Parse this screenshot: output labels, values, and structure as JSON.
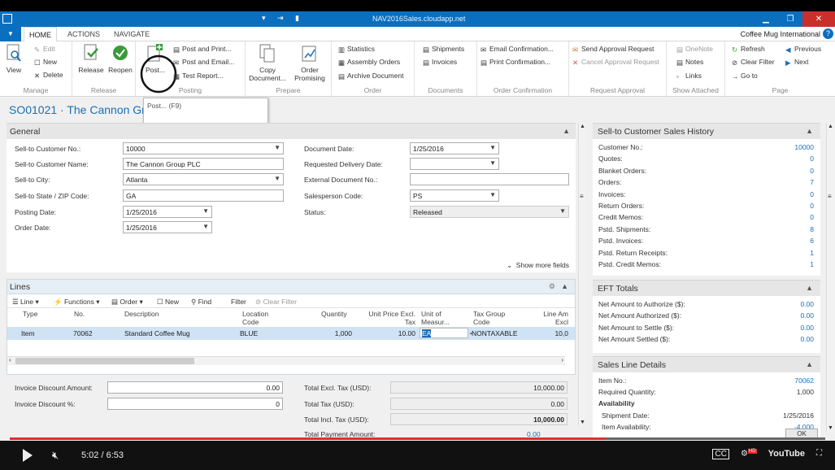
{
  "titlebar": {
    "title": "NAV2016Sales.cloudapp.net"
  },
  "tabs": {
    "home": "HOME",
    "actions": "ACTIONS",
    "navigate": "NAVIGATE",
    "company": "Coffee Mug International",
    "help": "?"
  },
  "ribbon": {
    "manage": {
      "name": "Manage",
      "view": "View",
      "edit": "Edit",
      "new": "New",
      "delete": "Delete"
    },
    "release": {
      "name": "Release",
      "release": "Release",
      "reopen": "Reopen"
    },
    "posting": {
      "name": "Posting",
      "post": "Post...",
      "post_print": "Post and Print...",
      "post_email": "Post and Email...",
      "test_report": "Test Report..."
    },
    "prepare": {
      "name": "Prepare",
      "copy_document": "Copy Document...",
      "order_promising": "Order Promising"
    },
    "order": {
      "name": "Order",
      "statistics": "Statistics",
      "assembly_orders": "Assembly Orders",
      "archive_document": "Archive Document"
    },
    "documents": {
      "name": "Documents",
      "shipments": "Shipments",
      "invoices": "Invoices"
    },
    "order_confirmation": {
      "name": "Order Confirmation",
      "email_confirmation": "Email Confirmation...",
      "print_confirmation": "Print Confirmation..."
    },
    "request_approval": {
      "name": "Request Approval",
      "send": "Send Approval Request",
      "cancel": "Cancel Approval Request"
    },
    "show_attached": {
      "name": "Show Attached",
      "onenote": "OneNote",
      "notes": "Notes",
      "links": "Links"
    },
    "page": {
      "name": "Page",
      "refresh": "Refresh",
      "clear_filter": "Clear Filter",
      "go_to": "Go to",
      "previous": "Previous",
      "next": "Next"
    }
  },
  "page_title": "SO01021 · The Cannon Grou",
  "tooltip": "Post... (F9)",
  "general": {
    "title": "General",
    "fields": {
      "sell_to_no_label": "Sell-to Customer No.:",
      "sell_to_no": "10000",
      "sell_to_name_label": "Sell-to Customer Name:",
      "sell_to_name": "The Cannon Group PLC",
      "city_label": "Sell-to City:",
      "city": "Atlanta",
      "state_label": "Sell-to State / ZIP Code:",
      "state": "GA",
      "posting_date_label": "Posting Date:",
      "posting_date": "1/25/2016",
      "order_date_label": "Order Date:",
      "order_date": "1/25/2016",
      "document_date_label": "Document Date:",
      "document_date": "1/25/2016",
      "req_delivery_label": "Requested Delivery Date:",
      "req_delivery": "",
      "ext_doc_label": "External Document No.:",
      "ext_doc": "",
      "salesperson_label": "Salesperson Code:",
      "salesperson": "PS",
      "status_label": "Status:",
      "status": "Released"
    },
    "show_more": "Show more fields"
  },
  "lines": {
    "title": "Lines",
    "toolbar": {
      "line": "Line",
      "functions": "Functions",
      "order": "Order",
      "new": "New",
      "find": "Find",
      "filter": "Filter",
      "clear_filter": "Clear Filter"
    },
    "columns": [
      "Type",
      "No.",
      "Description",
      "Location Code",
      "Quantity",
      "Unit Price Excl. Tax",
      "Unit of Measur...",
      "Tax Group Code",
      "Line Am Excl"
    ],
    "rows": [
      {
        "type": "Item",
        "no": "70062",
        "description": "Standard Coffee Mug",
        "location": "BLUE",
        "quantity": "1,000",
        "unit_price": "10.00",
        "uom": "EA",
        "tax_group": "NONTAXABLE",
        "line_amount": "10,0"
      }
    ]
  },
  "totals": {
    "inv_disc_amount_label": "Invoice Discount Amount:",
    "inv_disc_amount": "0.00",
    "inv_disc_pct_label": "Invoice Discount %:",
    "inv_disc_pct": "0",
    "total_excl_label": "Total Excl. Tax (USD):",
    "total_excl": "10,000.00",
    "total_tax_label": "Total Tax (USD):",
    "total_tax": "0.00",
    "total_incl_label": "Total Incl. Tax (USD):",
    "total_incl": "10,000.00",
    "total_payment_label": "Total Payment Amount:",
    "total_payment": "0.00"
  },
  "factbox": {
    "history": {
      "title": "Sell-to Customer Sales History",
      "rows": [
        {
          "label": "Customer No.:",
          "value": "10000"
        },
        {
          "label": "Quotes:",
          "value": "0"
        },
        {
          "label": "Blanket Orders:",
          "value": "0"
        },
        {
          "label": "Orders:",
          "value": "7"
        },
        {
          "label": "Invoices:",
          "value": "0"
        },
        {
          "label": "Return Orders:",
          "value": "0"
        },
        {
          "label": "Credit Memos:",
          "value": "0"
        },
        {
          "label": "Pstd. Shipments:",
          "value": "8"
        },
        {
          "label": "Pstd. Invoices:",
          "value": "6"
        },
        {
          "label": "Pstd. Return Receipts:",
          "value": "1"
        },
        {
          "label": "Pstd. Credit Memos:",
          "value": "1"
        }
      ]
    },
    "eft": {
      "title": "EFT Totals",
      "rows": [
        {
          "label": "Net Amount to Authorize ($):",
          "value": "0.00"
        },
        {
          "label": "Net Amount Authorized ($):",
          "value": "0.00"
        },
        {
          "label": "Net Amount to Settle ($):",
          "value": "0.00"
        },
        {
          "label": "Net Amount Settled ($):",
          "value": "0.00"
        }
      ]
    },
    "sales_line": {
      "title": "Sales Line Details",
      "item_no_label": "Item No.:",
      "item_no": "70062",
      "req_qty_label": "Required Quantity:",
      "req_qty": "1,000",
      "availability": "Availability",
      "shipment_date_label": "Shipment Date:",
      "shipment_date": "1/25/2016",
      "item_avail_label": "Item Availability:",
      "item_avail": "-4,000"
    }
  },
  "ok_label": "OK",
  "video": {
    "time": "5:02 / 6:53",
    "progress": 0.7312,
    "cc": "CC",
    "hd": "HD",
    "youtube": "YouTube"
  }
}
